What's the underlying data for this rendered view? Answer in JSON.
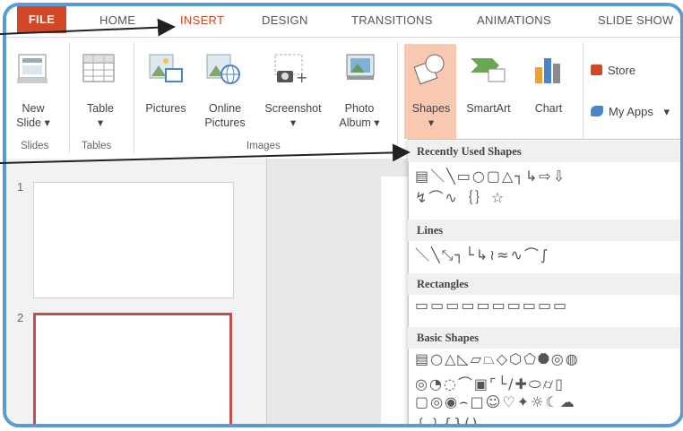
{
  "tabs": {
    "file": "FILE",
    "home": "HOME",
    "insert": "INSERT",
    "design": "DESIGN",
    "transitions": "TRANSITIONS",
    "animations": "ANIMATIONS",
    "slideshow": "SLIDE SHOW"
  },
  "ribbon": {
    "new_slide_1": "New",
    "new_slide_2": "Slide ▾",
    "table_1": "Table",
    "table_2": "▾",
    "pictures": "Pictures",
    "online_1": "Online",
    "online_2": "Pictures",
    "screenshot_1": "Screenshot",
    "screenshot_2": "▾",
    "photo_1": "Photo",
    "photo_2": "Album ▾",
    "shapes_1": "Shapes",
    "shapes_2": "▾",
    "smartart": "SmartArt",
    "chart": "Chart",
    "store": "Store",
    "myapps": "My Apps",
    "myapps_arrow": "▾",
    "group_slides": "Slides",
    "group_tables": "Tables",
    "group_images": "Images"
  },
  "slides": {
    "num1": "1",
    "num2": "2"
  },
  "shapes_menu": {
    "recent_header": "Recently Used Shapes",
    "recent_row1": "▤＼╲▭○▢△┐↳⇨⇩",
    "recent_row2": "↯⌒∿｛｝☆",
    "lines_header": "Lines",
    "lines_row": "＼╲⤡┐└↳≀≈∿⌒∫",
    "rect_header": "Rectangles",
    "rect_row": "▭▭▭▭▭▭▭▭▭▭",
    "basic_header": "Basic Shapes",
    "basic_row1": "▤○△◺▱⏢◇⬡⬠⯃◎◍",
    "basic_row2": "◎◔◌⌒▣⌜└∕✚⬭⌭▯",
    "basic_row3": "▢◎◉⌢□☺♡✦☼☾☁",
    "basic_row4": "❲❳{}()"
  },
  "colors": {
    "accent": "#d24726",
    "frame": "#5b9bd5",
    "shapes_highlight": "#f8c9b0"
  }
}
